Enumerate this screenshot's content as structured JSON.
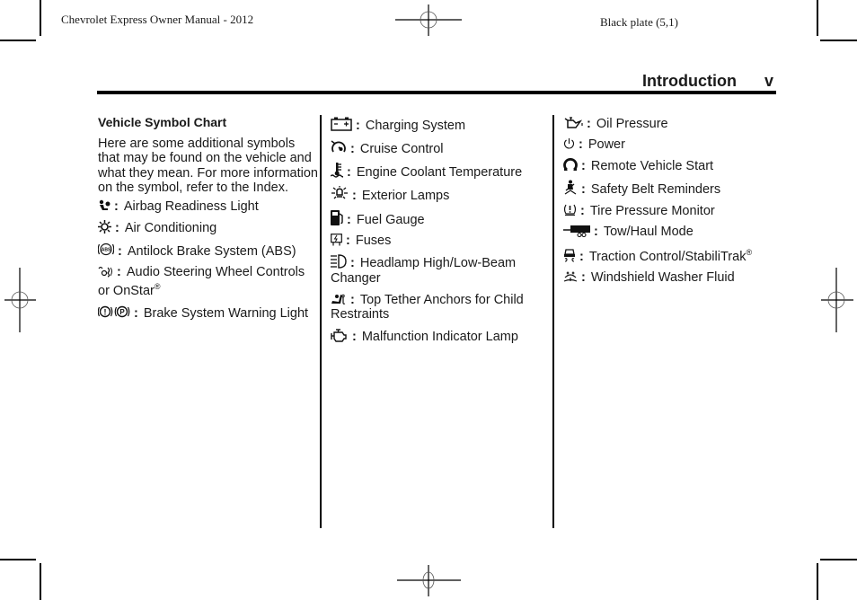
{
  "print_header": {
    "left": "Chevrolet Express Owner Manual - 2012",
    "right": "Black plate (5,1)"
  },
  "section": {
    "title": "Introduction",
    "page_number": "v"
  },
  "columns": [
    {
      "heading": "Vehicle Symbol Chart",
      "intro": "Here are some additional symbols that may be found on the vehicle and what they mean. For more information on the symbol, refer to the Index.",
      "items": [
        {
          "icon": "airbag-icon",
          "label": "Airbag Readiness Light"
        },
        {
          "icon": "air-conditioning-icon",
          "label": "Air Conditioning"
        },
        {
          "icon": "abs-icon",
          "label": "Antilock Brake System (ABS)"
        },
        {
          "icon": "audio-steering-controls-icon",
          "label": "Audio Steering Wheel Controls or OnStar",
          "sup": "®"
        },
        {
          "icon": "brake-warning-icon",
          "label": "Brake System Warning Light"
        }
      ]
    },
    {
      "items": [
        {
          "icon": "battery-icon",
          "label": "Charging System"
        },
        {
          "icon": "cruise-control-icon",
          "label": "Cruise Control"
        },
        {
          "icon": "coolant-temperature-icon",
          "label": "Engine Coolant Temperature"
        },
        {
          "icon": "exterior-lamps-icon",
          "label": "Exterior Lamps"
        },
        {
          "icon": "fuel-gauge-icon",
          "label": "Fuel Gauge"
        },
        {
          "icon": "fuse-icon",
          "label": "Fuses"
        },
        {
          "icon": "headlamp-beam-icon",
          "label": "Headlamp High/Low-Beam Changer"
        },
        {
          "icon": "top-tether-icon",
          "label": "Top Tether Anchors for Child Restraints"
        },
        {
          "icon": "engine-icon",
          "label": "Malfunction Indicator Lamp"
        }
      ]
    },
    {
      "items": [
        {
          "icon": "oil-can-icon",
          "label": "Oil Pressure"
        },
        {
          "icon": "power-icon",
          "label": "Power"
        },
        {
          "icon": "remote-start-icon",
          "label": "Remote Vehicle Start"
        },
        {
          "icon": "seatbelt-icon",
          "label": "Safety Belt Reminders"
        },
        {
          "icon": "tire-pressure-icon",
          "label": "Tire Pressure Monitor"
        },
        {
          "icon": "tow-haul-icon",
          "label": "Tow/Haul Mode"
        },
        {
          "icon": "traction-control-icon",
          "label": "Traction Control/StabiliTrak",
          "sup": "®"
        },
        {
          "icon": "washer-fluid-icon",
          "label": "Windshield Washer Fluid"
        }
      ]
    }
  ],
  "separator": ":"
}
